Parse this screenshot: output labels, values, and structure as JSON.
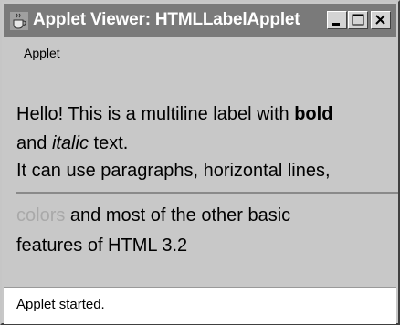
{
  "window": {
    "title": "Applet Viewer: HTMLLabelApplet",
    "icon": "java-coffee-cup-icon",
    "controls": [
      "minimize-icon",
      "maximize-icon",
      "close-icon"
    ]
  },
  "menu": {
    "items": [
      {
        "label": "Applet"
      }
    ]
  },
  "content": {
    "line1": {
      "prefix": "Hello! This is a multiline label with ",
      "bold": "bold"
    },
    "line2": {
      "prefix": "and ",
      "italic": "italic",
      "suffix": " text."
    },
    "line3": "It can use paragraphs, horizontal lines,",
    "line4": {
      "colored": "colors",
      "colored_color": "#a9a9a9",
      "suffix": " and most of the other basic"
    },
    "line5": "features of HTML 3.2"
  },
  "status": {
    "text": "Applet started."
  }
}
